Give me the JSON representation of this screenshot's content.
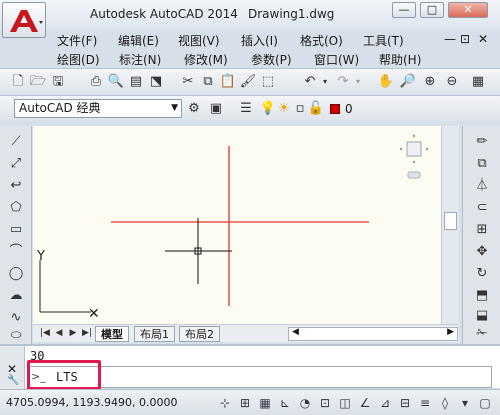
{
  "window": {
    "app_title": "Autodesk AutoCAD 2014",
    "doc_title": "Drawing1.dwg",
    "minimize": "—",
    "restore": "□",
    "close": "✕"
  },
  "menus": {
    "row1": [
      "文件(F)",
      "编辑(E)",
      "视图(V)",
      "插入(I)",
      "格式(O)",
      "工具(T)"
    ],
    "row2": [
      "绘图(D)",
      "标注(N)",
      "修改(M)",
      "参数(P)",
      "窗口(W)",
      "帮助(H)"
    ],
    "doc_controls": [
      "—",
      "⊡",
      "✕"
    ]
  },
  "workspace": {
    "name": "AutoCAD 经典",
    "layer_name": "0"
  },
  "layout_tabs": [
    "模型",
    "布局1",
    "布局2"
  ],
  "command": {
    "history": "30",
    "input": "LTS"
  },
  "status": {
    "coords": "4705.0994,  1193.9490,  0.0000"
  },
  "colors": {
    "crosshair": "#e0342b",
    "layer_swatch": "#d40000",
    "highlight": "#e0194e",
    "canvas_bg": "#fdfcf3"
  }
}
